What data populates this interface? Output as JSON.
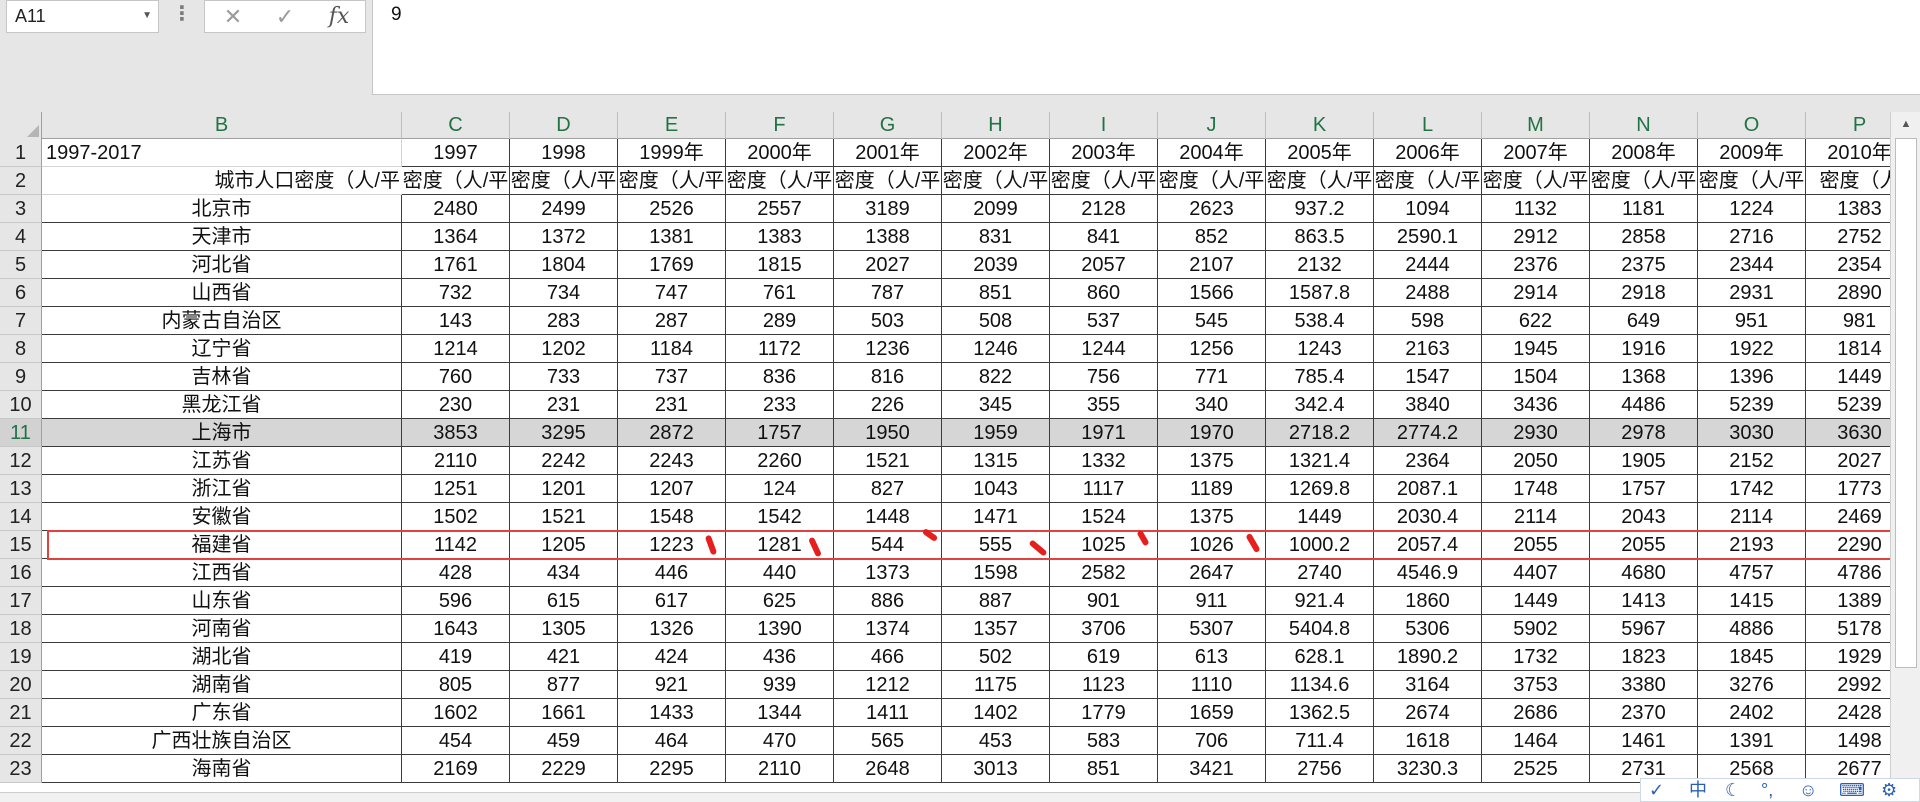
{
  "name_box": {
    "value": "A11"
  },
  "formula_bar": {
    "fx_label": "fx",
    "value": "9"
  },
  "columns": [
    "B",
    "C",
    "D",
    "E",
    "F",
    "G",
    "H",
    "I",
    "J",
    "K",
    "L",
    "M",
    "N",
    "O",
    "P"
  ],
  "rows": [
    {
      "num": "1",
      "cells": [
        "1997-2017",
        "1997",
        "1998",
        "1999年",
        "2000年",
        "2001年",
        "2002年",
        "2003年",
        "2004年",
        "2005年",
        "2006年",
        "2007年",
        "2008年",
        "2009年",
        "2010年"
      ]
    },
    {
      "num": "2",
      "cells": [
        "城市人口密度（人/平",
        "密度（人/平",
        "密度（人/平",
        "密度（人/平",
        "密度（人/平",
        "密度（人/平",
        "密度（人/平",
        "密度（人/平",
        "密度（人/平",
        "密度（人/平",
        "密度（人/平",
        "密度（人/平",
        "密度（人/平",
        "密度（人/平",
        "密度（人"
      ]
    },
    {
      "num": "3",
      "cells": [
        "北京市",
        "2480",
        "2499",
        "2526",
        "2557",
        "3189",
        "2099",
        "2128",
        "2623",
        "937.2",
        "1094",
        "1132",
        "1181",
        "1224",
        "1383"
      ]
    },
    {
      "num": "4",
      "cells": [
        "天津市",
        "1364",
        "1372",
        "1381",
        "1383",
        "1388",
        "831",
        "841",
        "852",
        "863.5",
        "2590.1",
        "2912",
        "2858",
        "2716",
        "2752"
      ]
    },
    {
      "num": "5",
      "cells": [
        "河北省",
        "1761",
        "1804",
        "1769",
        "1815",
        "2027",
        "2039",
        "2057",
        "2107",
        "2132",
        "2444",
        "2376",
        "2375",
        "2344",
        "2354"
      ]
    },
    {
      "num": "6",
      "cells": [
        "山西省",
        "732",
        "734",
        "747",
        "761",
        "787",
        "851",
        "860",
        "1566",
        "1587.8",
        "2488",
        "2914",
        "2918",
        "2931",
        "2890"
      ]
    },
    {
      "num": "7",
      "cells": [
        "内蒙古自治区",
        "143",
        "283",
        "287",
        "289",
        "503",
        "508",
        "537",
        "545",
        "538.4",
        "598",
        "622",
        "649",
        "951",
        "981"
      ]
    },
    {
      "num": "8",
      "cells": [
        "辽宁省",
        "1214",
        "1202",
        "1184",
        "1172",
        "1236",
        "1246",
        "1244",
        "1256",
        "1243",
        "2163",
        "1945",
        "1916",
        "1922",
        "1814"
      ]
    },
    {
      "num": "9",
      "cells": [
        "吉林省",
        "760",
        "733",
        "737",
        "836",
        "816",
        "822",
        "756",
        "771",
        "785.4",
        "1547",
        "1504",
        "1368",
        "1396",
        "1449"
      ]
    },
    {
      "num": "10",
      "cells": [
        "黑龙江省",
        "230",
        "231",
        "231",
        "233",
        "226",
        "345",
        "355",
        "340",
        "342.4",
        "3840",
        "3436",
        "4486",
        "5239",
        "5239"
      ]
    },
    {
      "num": "11",
      "cells": [
        "上海市",
        "3853",
        "3295",
        "2872",
        "1757",
        "1950",
        "1959",
        "1971",
        "1970",
        "2718.2",
        "2774.2",
        "2930",
        "2978",
        "3030",
        "3630"
      ]
    },
    {
      "num": "12",
      "cells": [
        "江苏省",
        "2110",
        "2242",
        "2243",
        "2260",
        "1521",
        "1315",
        "1332",
        "1375",
        "1321.4",
        "2364",
        "2050",
        "1905",
        "2152",
        "2027"
      ]
    },
    {
      "num": "13",
      "cells": [
        "浙江省",
        "1251",
        "1201",
        "1207",
        "124",
        "827",
        "1043",
        "1117",
        "1189",
        "1269.8",
        "2087.1",
        "1748",
        "1757",
        "1742",
        "1773"
      ]
    },
    {
      "num": "14",
      "cells": [
        "安徽省",
        "1502",
        "1521",
        "1548",
        "1542",
        "1448",
        "1471",
        "1524",
        "1375",
        "1449",
        "2030.4",
        "2114",
        "2043",
        "2114",
        "2469"
      ]
    },
    {
      "num": "15",
      "cells": [
        "福建省",
        "1142",
        "1205",
        "1223",
        "1281",
        "544",
        "555",
        "1025",
        "1026",
        "1000.2",
        "2057.4",
        "2055",
        "2055",
        "2193",
        "2290"
      ]
    },
    {
      "num": "16",
      "cells": [
        "江西省",
        "428",
        "434",
        "446",
        "440",
        "1373",
        "1598",
        "2582",
        "2647",
        "2740",
        "4546.9",
        "4407",
        "4680",
        "4757",
        "4786"
      ]
    },
    {
      "num": "17",
      "cells": [
        "山东省",
        "596",
        "615",
        "617",
        "625",
        "886",
        "887",
        "901",
        "911",
        "921.4",
        "1860",
        "1449",
        "1413",
        "1415",
        "1389"
      ]
    },
    {
      "num": "18",
      "cells": [
        "河南省",
        "1643",
        "1305",
        "1326",
        "1390",
        "1374",
        "1357",
        "3706",
        "5307",
        "5404.8",
        "5306",
        "5902",
        "5967",
        "4886",
        "5178"
      ]
    },
    {
      "num": "19",
      "cells": [
        "湖北省",
        "419",
        "421",
        "424",
        "436",
        "466",
        "502",
        "619",
        "613",
        "628.1",
        "1890.2",
        "1732",
        "1823",
        "1845",
        "1929"
      ]
    },
    {
      "num": "20",
      "cells": [
        "湖南省",
        "805",
        "877",
        "921",
        "939",
        "1212",
        "1175",
        "1123",
        "1110",
        "1134.6",
        "3164",
        "3753",
        "3380",
        "3276",
        "2992"
      ]
    },
    {
      "num": "21",
      "cells": [
        "广东省",
        "1602",
        "1661",
        "1433",
        "1344",
        "1411",
        "1402",
        "1779",
        "1659",
        "1362.5",
        "2674",
        "2686",
        "2370",
        "2402",
        "2428"
      ]
    },
    {
      "num": "22",
      "cells": [
        "广西壮族自治区",
        "454",
        "459",
        "464",
        "470",
        "565",
        "453",
        "583",
        "706",
        "711.4",
        "1618",
        "1464",
        "1461",
        "1391",
        "1498"
      ]
    },
    {
      "num": "23",
      "cells": [
        "海南省",
        "2169",
        "2229",
        "2295",
        "2110",
        "2648",
        "3013",
        "851",
        "3421",
        "2756",
        "3230.3",
        "2525",
        "2731",
        "2568",
        "2677"
      ]
    }
  ],
  "ime_toolbar": {
    "chinese": "中"
  }
}
